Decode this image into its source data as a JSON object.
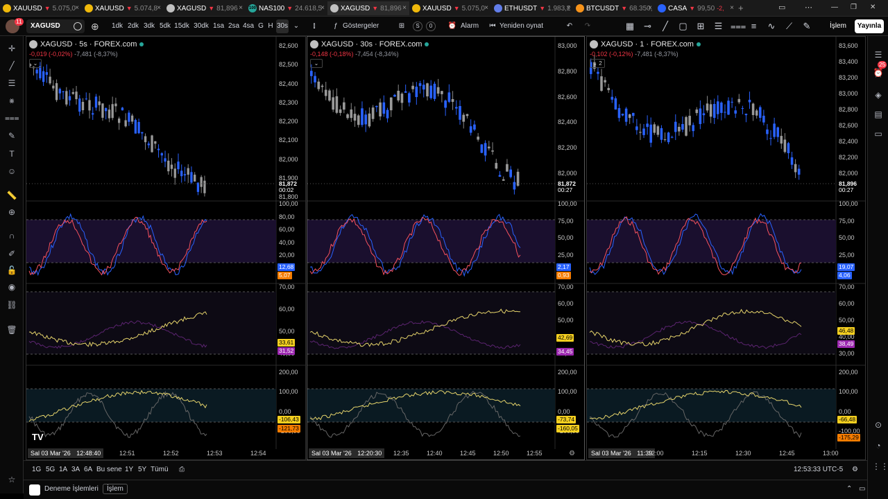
{
  "tabs": [
    {
      "name": "XAUUSD",
      "chg": "▼",
      "price": "5.075,0",
      "icon_color": "#f0b90b"
    },
    {
      "name": "XAUUSD",
      "chg": "▼",
      "price": "5.074,8",
      "icon_color": "#f0b90b"
    },
    {
      "name": "XAGUSD",
      "chg": "▼",
      "price": "81,896",
      "icon_color": "#c0c0c0"
    },
    {
      "name": "NAS100",
      "chg": "▼",
      "price": "24.618,5",
      "icon_color": "#26a69a",
      "icon_text": "100"
    },
    {
      "name": "XAGUSD",
      "chg": "▼",
      "price": "81,896",
      "icon_color": "#c0c0c0"
    },
    {
      "name": "XAUUSD",
      "chg": "▼",
      "price": "5.075,0",
      "icon_color": "#f0b90b"
    },
    {
      "name": "ETHUSDT",
      "chg": "▼",
      "price": "1.983,2",
      "icon_color": "#627eea"
    },
    {
      "name": "BTCUSDT",
      "chg": "▼",
      "price": "68.350,",
      "icon_color": "#f7931a"
    },
    {
      "name": "CASA",
      "chg": "▼",
      "price": "99,50",
      "extra": "-2,",
      "icon_color": "#2962ff"
    }
  ],
  "toolbar": {
    "avatar_badge": "11",
    "symbol": "XAGUSD",
    "intervals": [
      "1dk",
      "2dk",
      "3dk",
      "5dk",
      "15dk",
      "30dk",
      "1sa",
      "2sa",
      "4sa",
      "G",
      "H",
      "30s"
    ],
    "indicators": "Göstergeler",
    "alarm": "Alarm",
    "replay": "Yeniden oynat",
    "trade": "İşlem",
    "publish": "Yayınla",
    "counter_s": "S",
    "counter_0": "0"
  },
  "panels": [
    {
      "title": "XAGUSD · 5s · FOREX.com",
      "stat_a": "-0,019",
      "stat_b": "(-0,02%)",
      "stat_c": "-7,481 (-8,37%)",
      "collapse": "⌄",
      "price_axis": [
        "82,600",
        "82,500",
        "82,400",
        "82,300",
        "82,200",
        "82,100",
        "82,000",
        "81,900",
        "81,800"
      ],
      "last_price": "81,872",
      "last_time": "00:02",
      "rsi_axis": [
        "100,00",
        "80,00",
        "60,00",
        "40,00",
        "20,00"
      ],
      "rsi_a": "12,68",
      "rsi_b": "5,07",
      "ind2_axis": [
        "70,00",
        "60,00",
        "50,00",
        "40,00"
      ],
      "ind2_a": "33,61",
      "ind2_b": "31,52",
      "ind3_axis": [
        "200,00",
        "100,00",
        "0,00",
        "-200,00"
      ],
      "ind3_a": "-106,43",
      "ind3_b": "-121,73",
      "date": "Sal 03 Mar '26",
      "time": "12:48:40",
      "ticks": [
        "12:51",
        "12:52",
        "12:53",
        "12:54"
      ]
    },
    {
      "title": "XAGUSD · 30s · FOREX.com",
      "stat_a": "-0,148",
      "stat_b": "(-0,18%)",
      "stat_c": "-7,454 (-8,34%)",
      "collapse": "⌄",
      "price_axis": [
        "83,000",
        "82,800",
        "82,600",
        "82,400",
        "82,200",
        "82,000"
      ],
      "last_price": "81,872",
      "last_time": "00:27",
      "rsi_axis": [
        "100,00",
        "75,00",
        "50,00",
        "25,00"
      ],
      "rsi_a": "2,17",
      "rsi_b": "0,93",
      "ind2_axis": [
        "70,00",
        "60,00",
        "50,00",
        "40,00",
        "30,00"
      ],
      "ind2_a": "42,69",
      "ind2_b": "34,45",
      "ind3_axis": [
        "200,00",
        "100,00",
        "0,00",
        "-200,00"
      ],
      "ind3_a": "-73,74",
      "ind3_b": "-160,05",
      "date": "Sal 03 Mar '26",
      "time": "12:20:30",
      "ticks": [
        "12:35",
        "12:40",
        "12:45",
        "12:50",
        "12:55"
      ]
    },
    {
      "title": "XAGUSD · 1 · FOREX.com",
      "stat_a": "-0,102",
      "stat_b": "(-0,12%)",
      "stat_c": "-7,481 (-8,37%)",
      "collapse": "⌄ 2",
      "price_axis": [
        "83,600",
        "83,400",
        "83,200",
        "83,000",
        "82,800",
        "82,600",
        "82,400",
        "82,200",
        "82,000"
      ],
      "last_price": "81,896",
      "last_time": "00:27",
      "rsi_axis": [
        "100,00",
        "75,00",
        "50,00",
        "25,00"
      ],
      "rsi_a": "19,07",
      "rsi_b": "4,06",
      "ind2_axis": [
        "70,00",
        "60,00",
        "50,00",
        "40,00",
        "30,00"
      ],
      "ind2_a": "46,48",
      "ind2_b": "38,49",
      "ind3_axis": [
        "200,00",
        "100,00",
        "0,00",
        "-100,00"
      ],
      "ind3_a": "-66,48",
      "ind3_b": "-175,29",
      "date": "Sal 03 Mar '26",
      "time": "11:39",
      "ticks": [
        "12:00",
        "12:15",
        "12:30",
        "12:45",
        "13:00"
      ]
    }
  ],
  "bottom": {
    "ranges": [
      "1G",
      "5G",
      "1A",
      "3A",
      "6A",
      "Bu sene",
      "1Y",
      "5Y",
      "Tümü"
    ],
    "clock": "12:53:33 UTC-5"
  },
  "status": {
    "paper": "Deneme İşlemleri",
    "trade": "İşlem"
  },
  "right_badge": "25"
}
